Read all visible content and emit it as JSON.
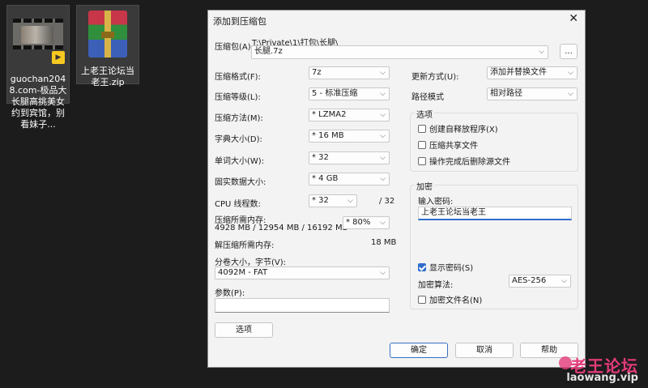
{
  "desktop": {
    "icons": [
      {
        "label": "guochan2048.com-极品大长腿高挑美女约到宾馆，别看妹子...",
        "type": "video"
      },
      {
        "label": "上老王论坛当老王.zip",
        "type": "archive"
      }
    ]
  },
  "dialog": {
    "title": "添加到压缩包",
    "close_icon": "close-icon",
    "archive": {
      "label": "压缩包(A):",
      "path": "T:\\Private\\1\\打包\\长腿\\",
      "name": "长腿.7z",
      "browse_label": "..."
    },
    "left": {
      "format": {
        "label": "压缩格式(F):",
        "value": "7z"
      },
      "level": {
        "label": "压缩等级(L):",
        "value": "5 - 标准压缩"
      },
      "method": {
        "label": "压缩方法(M):",
        "value": "*  LZMA2"
      },
      "dict": {
        "label": "字典大小(D):",
        "value": "*  16 MB"
      },
      "word": {
        "label": "单词大小(W):",
        "value": "*  32"
      },
      "solid": {
        "label": "固实数据大小:",
        "value": "*  4 GB"
      },
      "cpu": {
        "label": "CPU 线程数:",
        "value": "*  32",
        "total": "/ 32"
      },
      "mem_compress": {
        "label": "压缩所需内存:",
        "detail": "4928 MB / 12954 MB / 16192 MB",
        "value": "* 80%"
      },
      "mem_decompress": {
        "label": "解压缩所需内存:",
        "value": "18 MB"
      },
      "split": {
        "label": "分卷大小，字节(V):",
        "value": "4092M - FAT"
      },
      "params": {
        "label": "参数(P):",
        "value": ""
      },
      "options_button": "选项"
    },
    "right": {
      "update": {
        "label": "更新方式(U):",
        "value": "添加并替换文件"
      },
      "path_mode": {
        "label": "路径模式",
        "value": "相对路径"
      },
      "options_group": {
        "title": "选项",
        "sfx": {
          "label": "创建自释放程序(X)",
          "checked": false
        },
        "shared": {
          "label": "压缩共享文件",
          "checked": false
        },
        "delete_after": {
          "label": "操作完成后删除源文件",
          "checked": false
        }
      },
      "encryption": {
        "title": "加密",
        "password_label": "输入密码:",
        "password": "上老王论坛当老王",
        "show_password": {
          "label": "显示密码(S)",
          "checked": true
        },
        "method_label": "加密算法:",
        "method_value": "AES-256",
        "encrypt_names": {
          "label": "加密文件名(N)",
          "checked": false
        }
      }
    },
    "buttons": {
      "ok": "确定",
      "cancel": "取消",
      "help": "帮助"
    }
  },
  "watermark": {
    "title": "老王论坛",
    "url": "laowang.vip"
  }
}
